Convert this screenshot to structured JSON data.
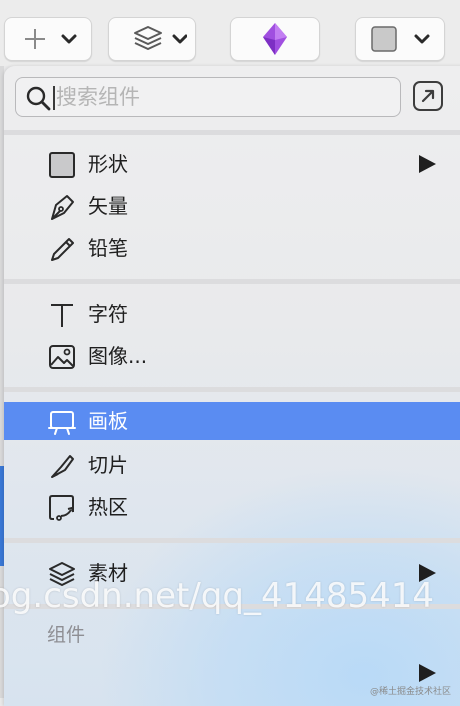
{
  "search": {
    "placeholder": "搜索组件",
    "value": ""
  },
  "menu": {
    "groups": [
      [
        {
          "label": "形状",
          "icon": "square-icon",
          "submenu": true
        },
        {
          "label": "矢量",
          "icon": "pen-icon"
        },
        {
          "label": "铅笔",
          "icon": "pencil-icon"
        }
      ],
      [
        {
          "label": "字符",
          "icon": "text-icon"
        },
        {
          "label": "图像...",
          "icon": "image-icon"
        }
      ],
      [
        {
          "label": "画板",
          "icon": "artboard-icon",
          "highlighted": true
        },
        {
          "label": "切片",
          "icon": "knife-icon"
        },
        {
          "label": "热区",
          "icon": "hotspot-icon"
        }
      ],
      [
        {
          "label": "素材",
          "icon": "layers-icon",
          "submenu": true
        }
      ]
    ],
    "components_header": "组件"
  },
  "watermark": "og.csdn.net/qq_41485414",
  "corner_watermark": "@稀土掘金技术社区",
  "colors": {
    "highlight": "#5a8cf2",
    "accent_gem": "#a04fe0"
  }
}
